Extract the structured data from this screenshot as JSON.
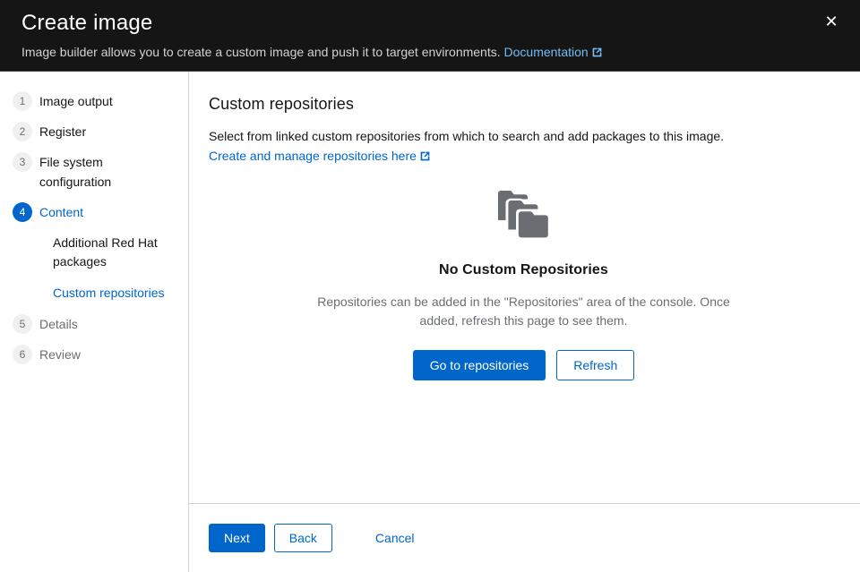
{
  "header": {
    "title": "Create image",
    "subtitle_text": "Image builder allows you to create a custom image and push it to target environments.",
    "documentation_link": "Documentation",
    "close_label": "✕",
    "background_color": "#151515",
    "link_color": "#73bcf7"
  },
  "nav": {
    "steps": [
      {
        "number": "1",
        "label": "Image output",
        "state": "default"
      },
      {
        "number": "2",
        "label": "Register",
        "state": "default"
      },
      {
        "number": "3",
        "label": "File system configuration",
        "state": "default"
      },
      {
        "number": "4",
        "label": "Content",
        "state": "current"
      },
      {
        "number": "5",
        "label": "Details",
        "state": "muted"
      },
      {
        "number": "6",
        "label": "Review",
        "state": "muted"
      }
    ],
    "substeps": [
      {
        "label": "Additional Red Hat packages",
        "state": "default"
      },
      {
        "label": "Custom repositories",
        "state": "active"
      }
    ],
    "active_color": "#0066cc"
  },
  "main": {
    "section_title": "Custom repositories",
    "section_description": "Select from linked custom repositories from which to search and add packages to this image.",
    "manage_link": "Create and manage repositories here",
    "empty_state": {
      "icon_name": "folders-icon",
      "icon_color": "#6a6e73",
      "title": "No Custom Repositories",
      "body": "Repositories can be added in the \"Repositories\" area of the console. Once added, refresh this page to see them.",
      "primary_button": "Go to repositories",
      "secondary_button": "Refresh"
    }
  },
  "footer": {
    "next_label": "Next",
    "back_label": "Back",
    "cancel_label": "Cancel"
  },
  "colors": {
    "primary": "#0066cc",
    "border": "#d2d2d2",
    "text": "#151515",
    "muted_text": "#6a6e73"
  }
}
